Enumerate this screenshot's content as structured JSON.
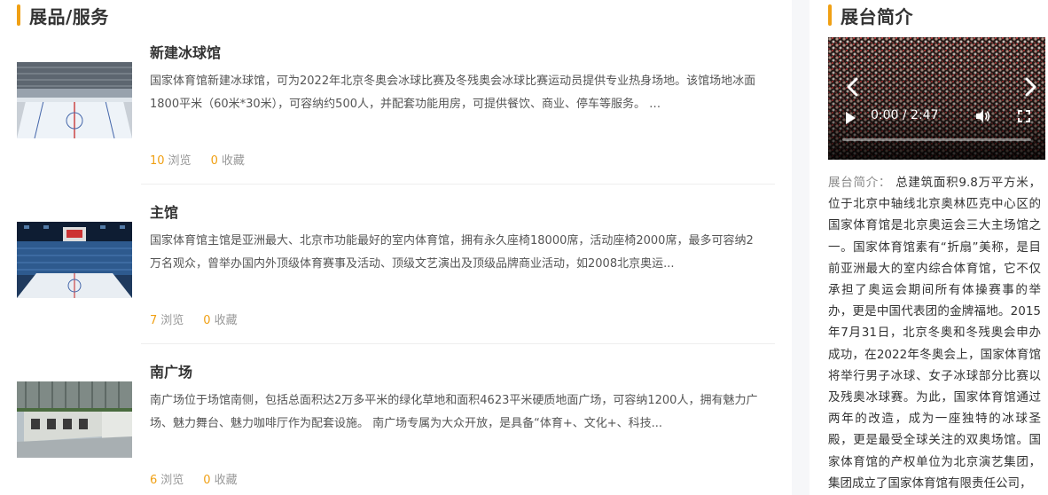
{
  "left_section": {
    "title": "展品/服务",
    "items": [
      {
        "title": "新建冰球馆",
        "desc": "国家体育馆新建冰球馆，可为2022年北京冬奥会冰球比赛及冬残奥会冰球比赛运动员提供专业热身场地。该馆场地冰面1800平米（60米*30米），可容纳约500人，并配套功能用房，可提供餐饮、商业、停车等服务。 …",
        "views": "10",
        "views_label": "浏览",
        "favs": "0",
        "favs_label": "收藏",
        "image": "ice-rink-photo"
      },
      {
        "title": "主馆",
        "desc": "国家体育馆主馆是亚洲最大、北京市功能最好的室内体育馆，拥有永久座椅18000席，活动座椅2000席，最多可容纳2万名观众，曾举办国内外顶级体育赛事及活动、顶级文艺演出及顶级品牌商业活动，如2008北京奥运...",
        "views": "7",
        "views_label": "浏览",
        "favs": "0",
        "favs_label": "收藏",
        "image": "main-arena-photo"
      },
      {
        "title": "南广场",
        "desc": "南广场位于场馆南侧，包括总面积达2万多平米的绿化草地和面积4623平米硬质地面广场，可容纳1200人，拥有魅力广场、魅力舞台、魅力咖啡厅作为配套设施。 南广场专属为大众开放，是具备“体育+、文化+、科技...",
        "views": "6",
        "views_label": "浏览",
        "favs": "0",
        "favs_label": "收藏",
        "image": "south-plaza-photo"
      }
    ]
  },
  "right_section": {
    "title": "展台简介",
    "video": {
      "time": "0:00 / 2:47",
      "progress": 0
    },
    "intro_label": "展台简介：",
    "intro_text": " 总建筑面积9.8万平方米，位于北京中轴线北京奥林匹克中心区的国家体育馆是北京奥运会三大主场馆之一。国家体育馆素有“折扇”美称，是目前亚洲最大的室内综合体育馆，它不仅承担了奥运会期间所有体操赛事的举办，更是中国代表团的金牌福地。2015年7月31日，北京冬奥和冬残奥会申办成功，在2022年冬奥会上，国家体育馆将举行男子冰球、女子冰球部分比赛以及残奥冰球赛。为此，国家体育馆通过两年的改造，成为一座独特的冰球圣殿，更是最受全球关注的双奥场馆。国家体育馆的产权单位为北京演艺集团，集团成立了国家体育馆有限责任公司，"
  },
  "colors": {
    "accent": "#f0a014",
    "text": "#333333",
    "muted": "#999999"
  }
}
